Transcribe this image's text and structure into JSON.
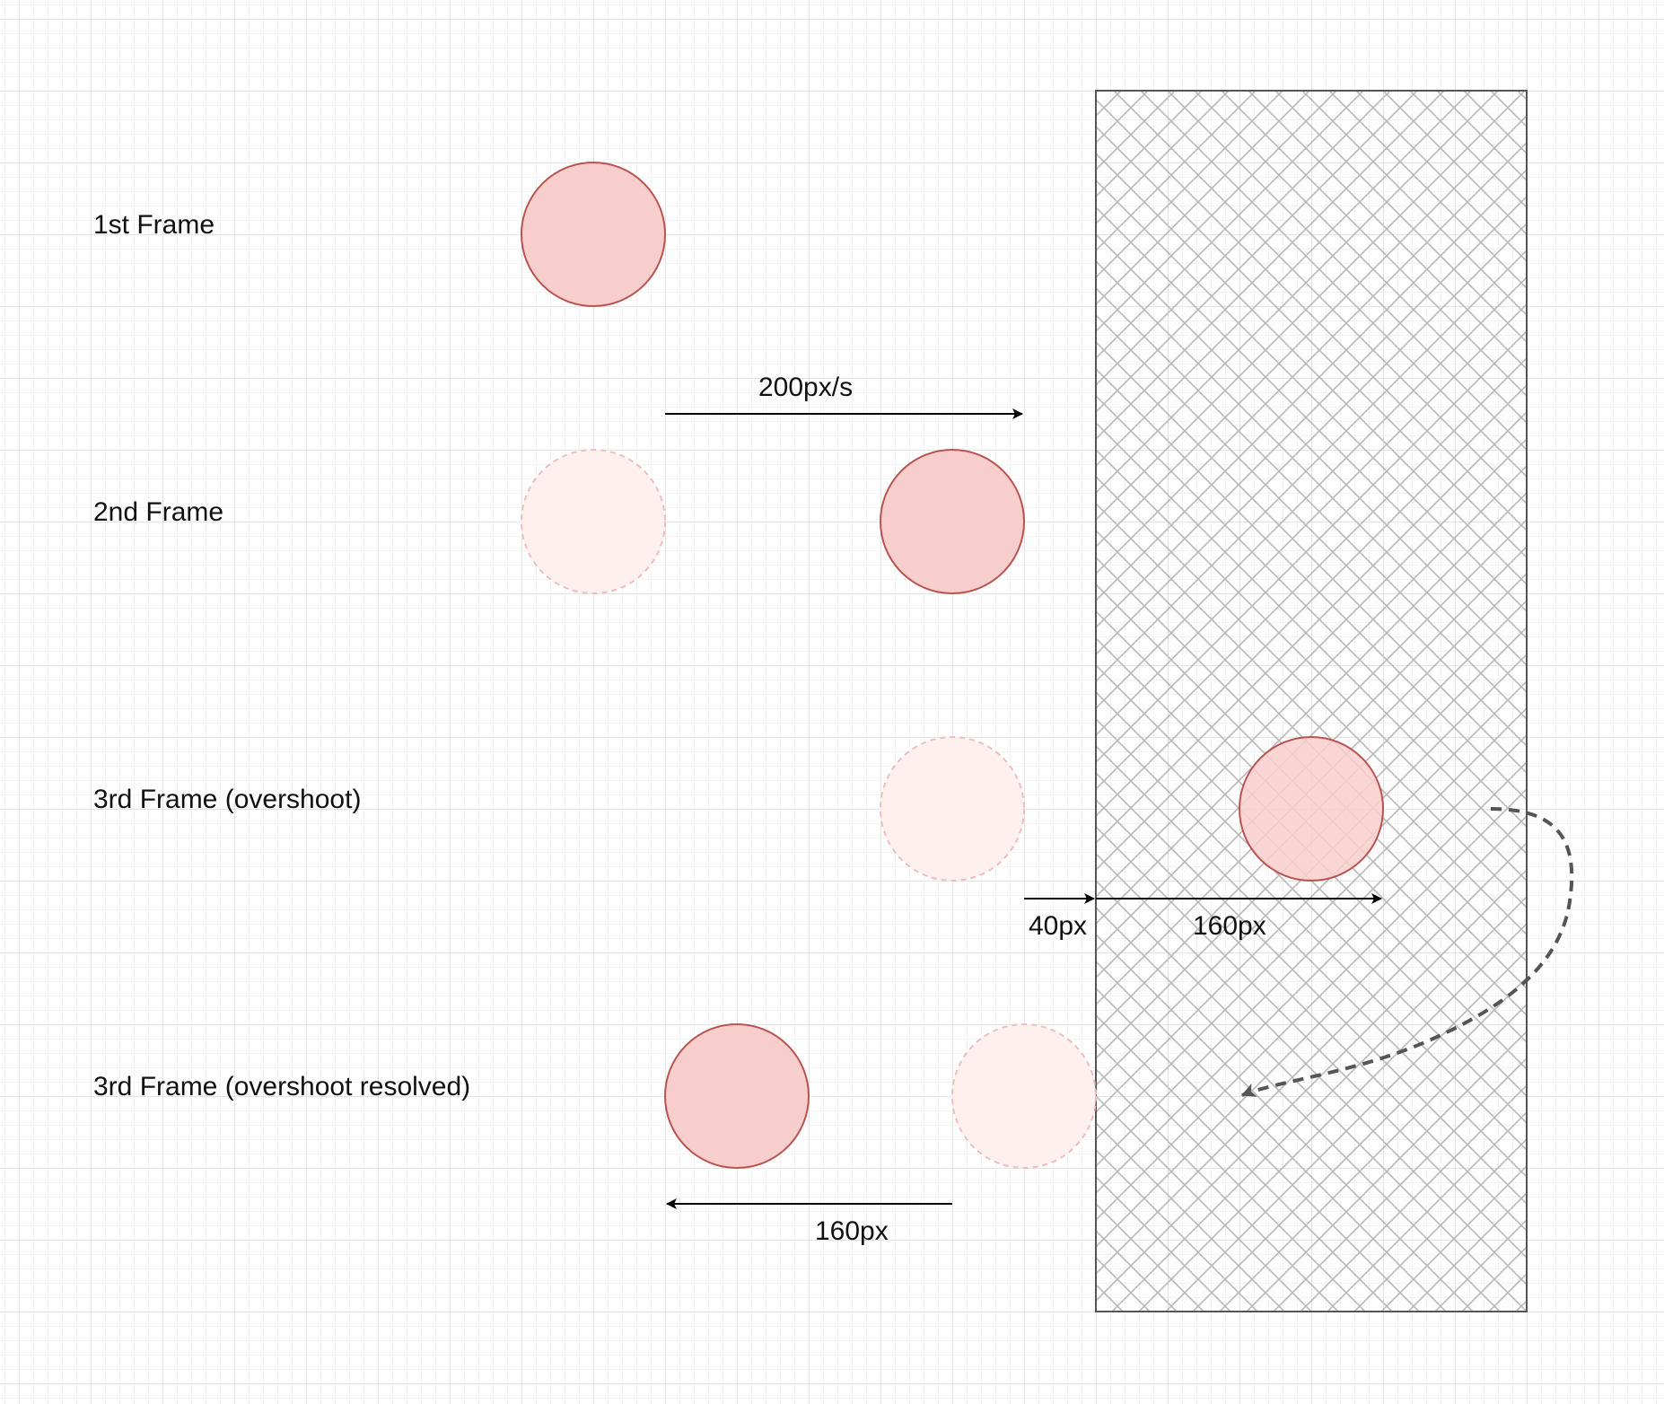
{
  "colors": {
    "ball_fill": "#f8cecc",
    "ball_stroke": "#b85450",
    "ghost_fill": "#fdf0ef",
    "ghost_stroke": "#f0bcbc",
    "wall_stroke": "#555555",
    "hatch": "#b8b8b8",
    "arrow": "#000000",
    "curve": "#555555"
  },
  "rows": [
    {
      "label": "1st Frame"
    },
    {
      "label": "2nd Frame"
    },
    {
      "label": "3rd Frame (overshoot)"
    },
    {
      "label": "3rd Frame (overshoot resolved)"
    }
  ],
  "annotations": {
    "velocity": "200px/s",
    "penetration_before_wall": "40px",
    "penetration_into_wall": "160px",
    "pushback": "160px"
  }
}
